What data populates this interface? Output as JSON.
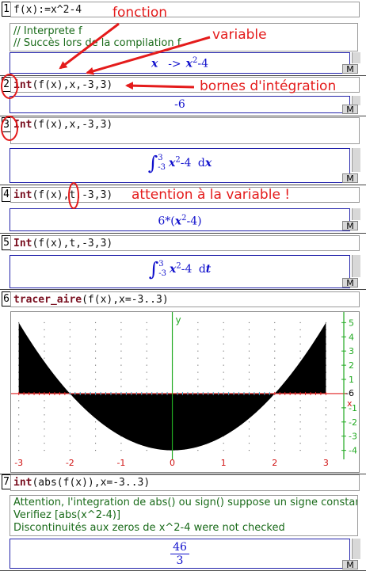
{
  "annotations": {
    "fonction": "fonction",
    "variable": "variable",
    "bornes": "bornes d'intégration",
    "attention": "attention à la variable !",
    "color": "#e41b1b"
  },
  "entries": [
    {
      "num": "1",
      "cmd": "f(x):=x^2-4",
      "messages": [
        "// Interprete f",
        "// Succès lors de la compilation f"
      ],
      "result": {
        "lhs": "x",
        "arrow": "->",
        "rhs_base": "x",
        "rhs_exp": "2",
        "rhs_tail": "-4"
      }
    },
    {
      "num": "2",
      "kw": "int",
      "cmd_rest": "(f(x),x,-3,3)",
      "result": "-6"
    },
    {
      "num": "3",
      "kw": "Int",
      "cmd_rest": "(f(x),x,-3,3)",
      "integral": {
        "upper": "3",
        "lower": "-3",
        "base": "x",
        "exp": "2",
        "tail": "-4",
        "d": "d",
        "var": "x"
      }
    },
    {
      "num": "4",
      "kw": "int",
      "cmd_rest": "(f(x),t,-3,3)",
      "result": {
        "pre": "6*(",
        "base": "x",
        "exp": "2",
        "post": "-4)"
      }
    },
    {
      "num": "5",
      "kw": "Int",
      "cmd_rest": "(f(x),t,-3,3)",
      "integral": {
        "upper": "3",
        "lower": "-3",
        "base": "x",
        "exp": "2",
        "tail": "-4",
        "d": "d",
        "var": "t"
      }
    },
    {
      "num": "6",
      "kw": "tracer_aire",
      "cmd_rest": "(f(x),x=-3..3)"
    },
    {
      "num": "7",
      "kw": "int",
      "cmd_rest": "(abs(f(x)),x=-3..3)",
      "messages": [
        "Attention, l'integration de abs() ou sign() suppose un signe constant",
        " Verifiez [abs(x^2-4)]",
        "Discontinuités aux zeros de x^2-4 were not checked"
      ],
      "result": {
        "numerator": "46",
        "denominator": "3"
      }
    }
  ],
  "m_button": "M",
  "plot": {
    "x_ticks": [
      "-3",
      "-2",
      "-1",
      "0",
      "1",
      "2",
      "3"
    ],
    "y_ticks": [
      "5",
      "4",
      "3",
      "2",
      "1",
      "-1",
      "-2",
      "-3",
      "-4"
    ],
    "y_axis_label": "y",
    "x_axis_label": "x",
    "right_marker": "-6",
    "function": "x^2-4",
    "xlim": [
      -3.15,
      3.35
    ],
    "ylim": [
      -4.3,
      5.3
    ],
    "fill_range": [
      -3,
      3
    ],
    "fill_color": "#000000",
    "axis_x_color": "#e02020",
    "axis_y_color": "#22aa22"
  }
}
